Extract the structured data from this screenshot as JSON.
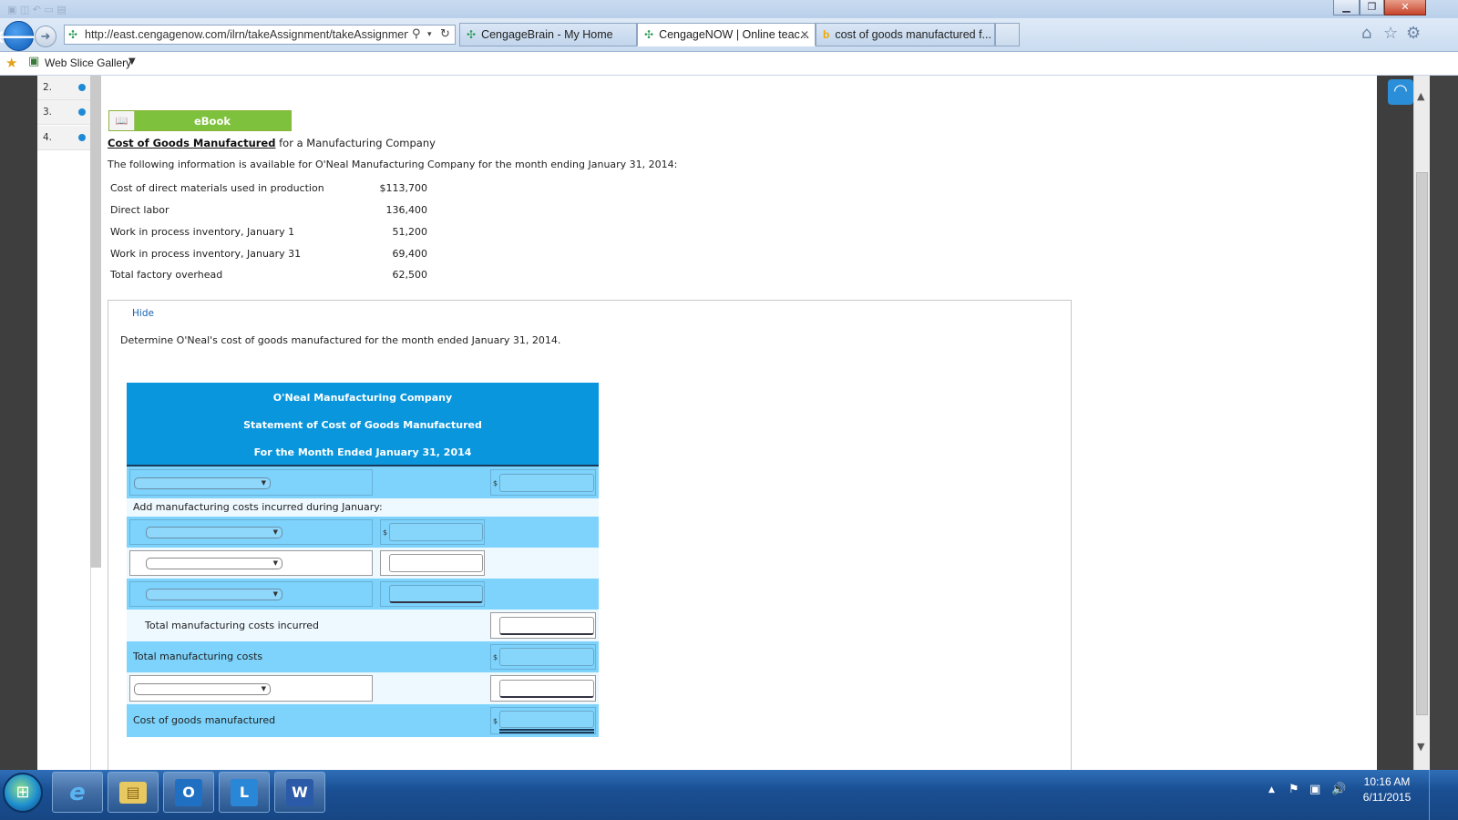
{
  "browser": {
    "address_url": "http://east.cengagenow.com/ilrn/takeAssignment/takeAssignmentI",
    "tabs": [
      {
        "label": "CengageBrain - My Home",
        "active": false
      },
      {
        "label": "CengageNOW | Online teac...",
        "active": true
      },
      {
        "label": "cost of goods manufactured f...",
        "active": false
      }
    ],
    "favorites_bar": {
      "web_slice_gallery": "Web Slice Gallery"
    }
  },
  "question_nav": {
    "items": [
      "2.",
      "3.",
      "4."
    ],
    "status_color": "#1e8ad6"
  },
  "ebook": {
    "label": "eBook"
  },
  "problem": {
    "title_link": "Cost of Goods Manufactured",
    "title_rest": " for a Manufacturing Company",
    "intro": "The following information is available for O'Neal Manufacturing Company for the month ending January 31, 2014:",
    "data": [
      {
        "label": "Cost of direct materials used in production",
        "value": "$113,700"
      },
      {
        "label": "Direct labor",
        "value": "136,400"
      },
      {
        "label": "Work in process inventory, January 1",
        "value": "51,200"
      },
      {
        "label": "Work in process inventory, January 31",
        "value": "69,400"
      },
      {
        "label": "Total factory overhead",
        "value": "62,500"
      }
    ]
  },
  "question": {
    "hide_link": "Hide",
    "instruction": "Determine O'Neal's cost of goods manufactured for the month ended January 31, 2014.",
    "statement": {
      "header": [
        "O'Neal Manufacturing Company",
        "Statement of Cost of Goods Manufactured",
        "For the Month Ended January 31, 2014"
      ],
      "dollar_sign": "$",
      "add_costs_label": "Add manufacturing costs incurred during January:",
      "total_incurred_label": "Total manufacturing costs incurred",
      "total_costs_label": "Total manufacturing costs",
      "cogm_label": "Cost of goods manufactured"
    }
  },
  "taskbar": {
    "time": "10:16 AM",
    "date": "6/11/2015"
  },
  "colors": {
    "header_blue": "#0a96dc",
    "row_blue": "#7dd3fb",
    "ebook_green": "#7ec13c"
  }
}
